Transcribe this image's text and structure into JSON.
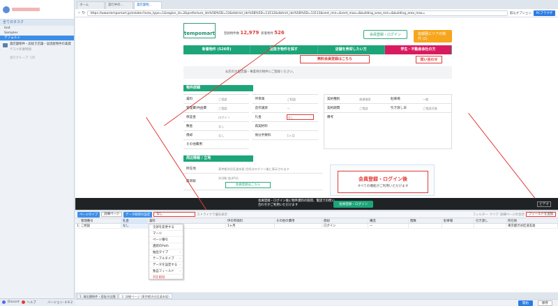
{
  "left": {
    "section_all": "全てのタスク",
    "tree": [
      "test",
      "Samples",
      "デフォルト"
    ],
    "task": {
      "title": "貸店舗物件・居抜き店舗・居酒屋物件の賃貸",
      "sub": "テスト所要時間"
    },
    "task2": "実行グループ: 1月",
    "bottom_a": "Discord",
    "bottom_b": "ヘルプ",
    "version": "バージョン: 4.9.2"
  },
  "browser": {
    "tabs": [
      "ホーム",
      "実行中の...",
      "貸店舗物..."
    ],
    "url": "https://www.tempomart.jp/estates?area_type=1&region_id=2&prefecture_ids%5B%5D=13&district_ids%5B%5D=13112&district_ids%5B%5D=13113&rent_min=&rent_max=&building_area_min=&building_area_max=",
    "right_text": "取込オプション",
    "pc_button": "PCブラウザ"
  },
  "site": {
    "logo": "tempomart",
    "stat1_label": "登録物件数",
    "stat1_value": "12,979",
    "stat2_label": "新着物件",
    "stat2_value": "526",
    "register_btn": "会員登録・ログイン",
    "yellow_btn": "首都圏エリアの物件 (2)",
    "nav": [
      "新着物件 (526件)",
      "居抜き物件を探す",
      "店舗を売却したい方",
      "学生・不動産会社の方"
    ],
    "free_reg": "無料会員登録はこちら",
    "inquiry": "問い合わせ",
    "notice": "お店の大型店舗・事業用の物件にご登録ください。",
    "section1": "物件詳細",
    "left_rows": [
      {
        "k": "賃料",
        "v": "ご相談"
      },
      {
        "k": "管理費/共益費",
        "v": "ご相談"
      },
      {
        "k": "保証金",
        "v": "ログイン"
      },
      {
        "k": "敷金",
        "v": "なし"
      },
      {
        "k": "償却",
        "v": "なし"
      },
      {
        "k": "その他費用",
        "v": ""
      }
    ],
    "mid_rows": [
      {
        "k": "坪単価",
        "v": "ご相談"
      },
      {
        "k": "造作譲渡",
        "v": "ー"
      },
      {
        "k": "礼金",
        "v": "なし"
      },
      {
        "k": "再契約料",
        "v": ""
      },
      {
        "k": "保分手数料",
        "v": "1ヶ月"
      }
    ],
    "right_rows": [
      {
        "k": "契約種別",
        "v": "普通借家",
        "k2": "駐車場",
        "v2": "一般"
      },
      {
        "k": "契約期間",
        "v": "ご相談",
        "k2": "引き渡し日",
        "v2": "ご相談可能"
      },
      {
        "k": "備考",
        "v": "",
        "k2": "",
        "v2": ""
      }
    ],
    "section2": "周辺情報 / 立地",
    "addr_label": "所在地",
    "addr_value": "東京都渋谷区道玄坂 住所はログイン後に表示されます",
    "station_label": "最寄駅",
    "station_value": "渋谷駅 徒歩5分",
    "register_green": "会員登録はこちら",
    "member_title": "会員登録・ログイン後",
    "member_sub": "すべての機能がご利用いただけます"
  },
  "overlay": {
    "text": "会員登録・ログイン後に物件資料の取得、電話での問い合わせがご利用いただけます",
    "button": "会員登録・ログイン",
    "viewmode": "ビデオ"
  },
  "toolbar": {
    "type_label": "ページタイプ",
    "type_value": "詳細ページ",
    "mode_label": "データ取得の設定",
    "mode_value": "なし",
    "hint": "ストライクで優先表示",
    "filter": "フィルター",
    "clear": "クリア",
    "dedupe": "詳細ページの合計",
    "field_btn": "フィールドを追加"
  },
  "grid": {
    "columns": [
      "管理番号",
      "礼金",
      "賃料",
      "坪の単価料",
      "その他の費用",
      "償却",
      "構造",
      "階数",
      "駐車場",
      "引き渡し",
      "所在地"
    ],
    "row": [
      "ご相談",
      "なし",
      "",
      "1ヶ月",
      "",
      "ログイン",
      "ー",
      "",
      "",
      "",
      "東京都渋谷区道玄坂"
    ]
  },
  "context_menu": [
    "全部を変更する",
    "マージ",
    "ページ番号",
    "連続のPath",
    "抽出タイプ",
    "テーブルタイプ",
    "データを設定する",
    "独自フィールド",
    "列を削除"
  ],
  "task_tabs": [
    "1. 貸店舗物件・居抜き店舗",
    "2. 詳細ページ (東京都渋谷区道玄坂)"
  ],
  "status": {
    "start": "開始",
    "save": "保存"
  }
}
